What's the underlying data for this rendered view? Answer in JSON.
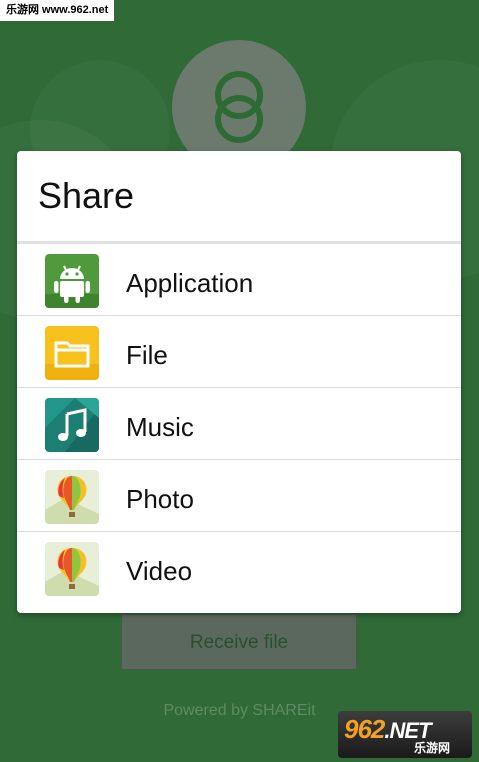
{
  "watermark": {
    "top_text": "乐游网 www.962.net",
    "logo_big": "962",
    "logo_net": ".NET",
    "logo_small": "乐游网"
  },
  "dialog": {
    "title": "Share",
    "items": [
      {
        "label": "Application",
        "icon": "android-icon"
      },
      {
        "label": "File",
        "icon": "folder-icon"
      },
      {
        "label": "Music",
        "icon": "music-note-icon"
      },
      {
        "label": "Photo",
        "icon": "balloon-photo-icon"
      },
      {
        "label": "Video",
        "icon": "balloon-video-icon"
      }
    ]
  },
  "background": {
    "receive_button_label": "Receive file",
    "powered_by": "Powered by SHAREit"
  },
  "colors": {
    "background_green": "#2f6a37",
    "logo_circle": "#6c7a6e",
    "logo_ring": "#2d6a34",
    "dialog_bg": "#ffffff"
  }
}
